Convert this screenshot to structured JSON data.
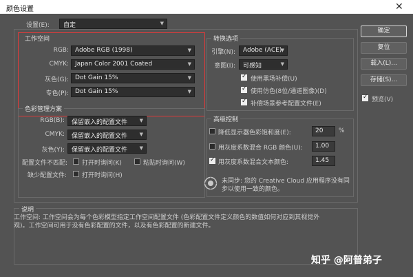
{
  "window": {
    "title": "颜色设置",
    "close_glyph": "✕"
  },
  "settings": {
    "label": "设置(E):",
    "value": "自定"
  },
  "working_spaces": {
    "title": "工作空间",
    "rgb": {
      "label": "RGB:",
      "value": "Adobe RGB (1998)"
    },
    "cmyk": {
      "label": "CMYK:",
      "value": "Japan Color 2001 Coated"
    },
    "gray": {
      "label": "灰色(G):",
      "value": "Dot Gain 15%"
    },
    "spot": {
      "label": "专色(P):",
      "value": "Dot Gain 15%"
    }
  },
  "color_management": {
    "title": "色彩管理方案",
    "rgb": {
      "label": "RGB(B):",
      "value": "保留嵌入的配置文件"
    },
    "cmyk": {
      "label": "CMYK:",
      "value": "保留嵌入的配置文件"
    },
    "gray": {
      "label": "灰色(Y):",
      "value": "保留嵌入的配置文件"
    },
    "mismatch_label": "配置文件不匹配:",
    "ask_open_1": "打开时询问(K)",
    "ask_paste": "粘贴时询问(W)",
    "missing_label": "缺少配置文件:",
    "ask_open_2": "打开时询问(H)"
  },
  "conversion": {
    "title": "转换选项",
    "engine_label": "引擎(N):",
    "engine_value": "Adobe (ACE)",
    "intent_label": "意图(I):",
    "intent_value": "可感知",
    "bpc": "使用黑场补偿(U)",
    "dither": "使用仿色(8位/通道图像)(D)",
    "compensate": "补偿场景参考配置文件(E)"
  },
  "advanced": {
    "title": "高级控制",
    "desaturate": "降低显示器色彩饱和度(E):",
    "desaturate_value": "20",
    "desaturate_unit": "%",
    "blend_rgb": "用灰度系数混合 RGB 颜色(U):",
    "blend_rgb_value": "1.00",
    "blend_text": "用灰度系数混合文本颜色:",
    "blend_text_value": "1.45"
  },
  "sync": {
    "icon": "creative-cloud-sync-icon",
    "line1": "未同步: 您的 Creative Cloud 应用程序没有同",
    "line2": "步以使用一致的颜色。"
  },
  "description": {
    "title": "说明",
    "line1": "工作空间: 工作空间会为每个色彩模型指定工作空间配置文件 (色彩配置文件定义颜色的数值如何对应到其视觉外",
    "line2": "观)。工作空间可用于没有色彩配置的文件，以及有色彩配置的新建文件。"
  },
  "buttons": {
    "ok": "确定",
    "reset": "复位",
    "load": "载入(L)...",
    "save": "存储(S)...",
    "preview": "预览(V)"
  },
  "watermark": "知乎 @阿普弟子",
  "colors": {
    "dialog_bg": "#535353",
    "highlight_box": "#e23a3a",
    "dropdown_bg": "#2e2e2e"
  }
}
